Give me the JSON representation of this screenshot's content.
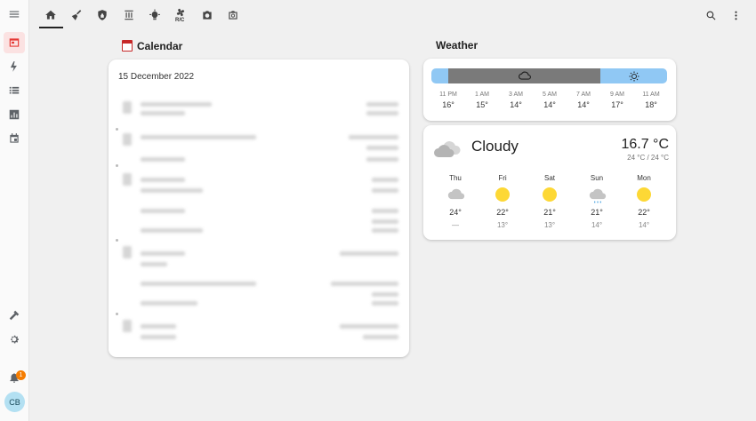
{
  "sidebar": {
    "items": [
      "menu-icon",
      "calendar-icon",
      "energy-icon",
      "list-icon",
      "chart-icon",
      "calendar-view-icon",
      "hammer-icon",
      "gear-icon",
      "bell-icon"
    ],
    "notification_count": "1",
    "avatar_initials": "CB"
  },
  "topbar": {
    "tabs": [
      "home-icon",
      "broom-icon",
      "shield-icon",
      "heater-icon",
      "bulb-icon",
      "fan-icon",
      "camera-icon",
      "camera-outline-icon"
    ],
    "fan_label": "R/C"
  },
  "calendar": {
    "title": "Calendar",
    "date": "15 December 2022"
  },
  "weather": {
    "title": "Weather",
    "hourly": [
      {
        "time": "11 PM",
        "temp": "16°"
      },
      {
        "time": "1 AM",
        "temp": "15°"
      },
      {
        "time": "3 AM",
        "temp": "14°"
      },
      {
        "time": "5 AM",
        "temp": "14°"
      },
      {
        "time": "7 AM",
        "temp": "14°"
      },
      {
        "time": "9 AM",
        "temp": "17°"
      },
      {
        "time": "11 AM",
        "temp": "18°"
      }
    ],
    "condition": "Cloudy",
    "temperature": "16.7 °C",
    "temp_range": "24 °C / 24 °C",
    "forecast": [
      {
        "day": "Thu",
        "icon": "cloud",
        "high": "24°",
        "low": "—"
      },
      {
        "day": "Fri",
        "icon": "sun",
        "high": "22°",
        "low": "13°"
      },
      {
        "day": "Sat",
        "icon": "sun",
        "high": "21°",
        "low": "13°"
      },
      {
        "day": "Sun",
        "icon": "rain",
        "high": "21°",
        "low": "14°"
      },
      {
        "day": "Mon",
        "icon": "sun",
        "high": "22°",
        "low": "14°"
      }
    ]
  }
}
